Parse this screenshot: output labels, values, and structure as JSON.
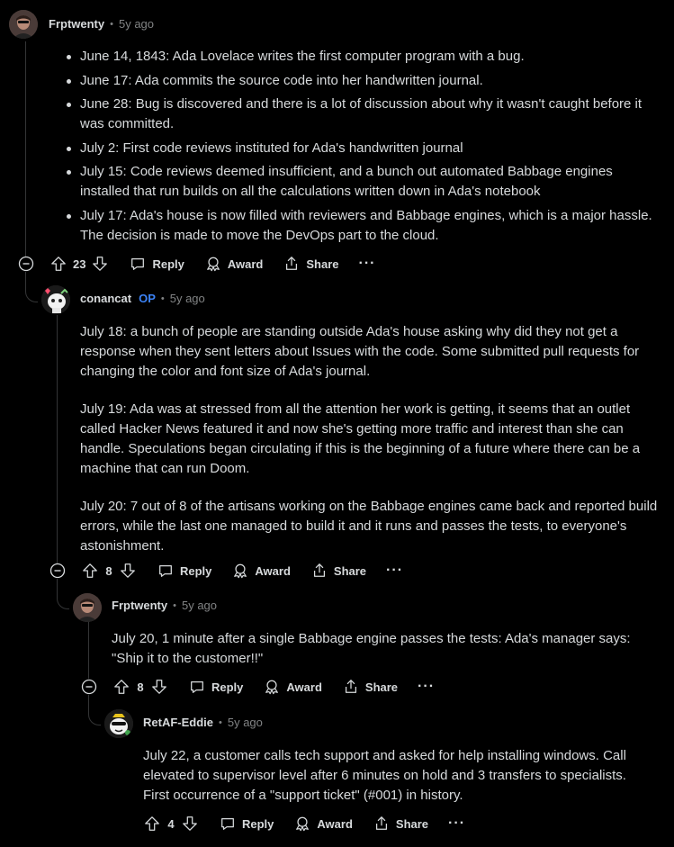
{
  "labels": {
    "reply": "Reply",
    "award": "Award",
    "share": "Share",
    "more": "···",
    "op_badge": "OP",
    "separator": "•"
  },
  "comments": [
    {
      "author": "Frptwenty",
      "time": "5y ago",
      "bullets": [
        "June 14, 1843: Ada Lovelace writes the first computer program with a bug.",
        "June 17: Ada commits the source code into her handwritten journal.",
        "June 28: Bug is discovered and there is a lot of discussion about why it wasn't caught before it was committed.",
        "July 2: First code reviews instituted for Ada's handwritten journal",
        "July 15: Code reviews deemed insufficient, and a bunch out automated Babbage engines installed that run builds on all the calculations written down in Ada's notebook",
        "July 17: Ada's house is now filled with reviewers and Babbage engines, which is a major hassle. The decision is made to move the DevOps part to the cloud."
      ],
      "score": "23"
    },
    {
      "author": "conancat",
      "is_op": true,
      "time": "5y ago",
      "paragraphs": [
        "July 18: a bunch of people are standing outside Ada's house asking why did they not get a response when they sent letters about Issues with the code. Some submitted pull requests for changing the color and font size of Ada's journal.",
        "July 19: Ada was at stressed from all the attention her work is getting, it seems that an outlet called Hacker News featured it and now she's getting more traffic and interest than she can handle. Speculations began circulating if this is the beginning of a future where there can be a machine that can run Doom.",
        "July 20: 7 out of 8 of the artisans working on the Babbage engines came back and reported build errors, while the last one managed to build it and it runs and passes the tests, to everyone's astonishment."
      ],
      "score": "8"
    },
    {
      "author": "Frptwenty",
      "time": "5y ago",
      "paragraphs": [
        "July 20, 1 minute after a single Babbage engine passes the tests: Ada's manager says: \"Ship it to the customer!!\""
      ],
      "score": "8"
    },
    {
      "author": "RetAF-Eddie",
      "time": "5y ago",
      "paragraphs": [
        "July 22, a customer calls tech support and asked for help installing windows. Call elevated to supervisor level after 6 minutes on hold and 3 transfers to specialists. First occurrence of a \"support ticket\" (#001) in history."
      ],
      "score": "4"
    }
  ],
  "colors": {
    "background": "#000000",
    "text": "#d7dadc",
    "muted": "#818384",
    "op": "#3b82f6",
    "thread_line": "#343536"
  }
}
